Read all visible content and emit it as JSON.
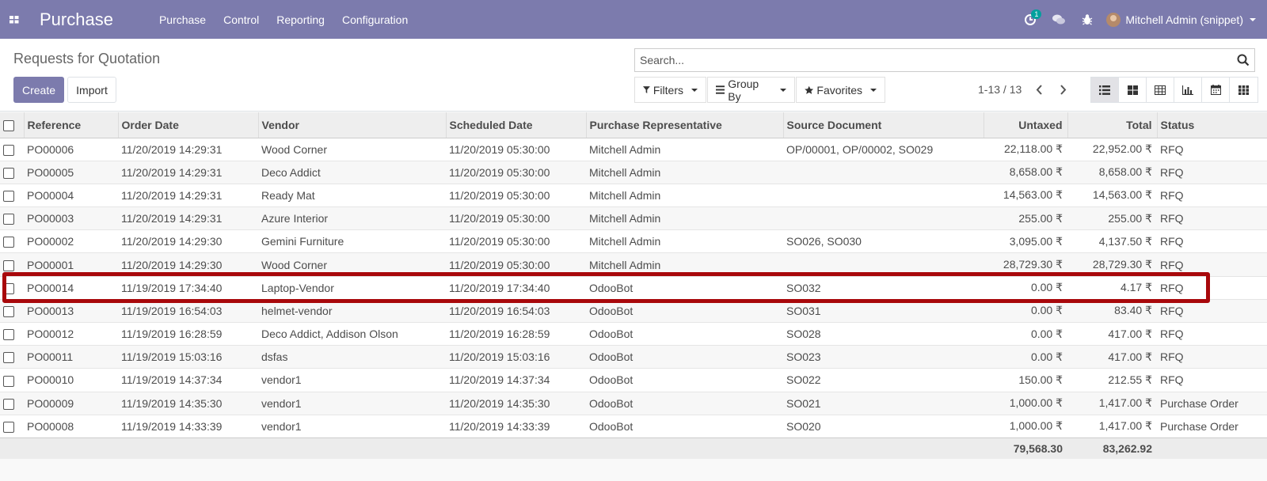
{
  "navbar": {
    "brand": "Purchase",
    "menu": [
      "Purchase",
      "Control",
      "Reporting",
      "Configuration"
    ],
    "activity_count": "1",
    "user": "Mitchell Admin (snippet)"
  },
  "control": {
    "title": "Requests for Quotation",
    "create_label": "Create",
    "import_label": "Import",
    "search_placeholder": "Search...",
    "filters_label": "Filters",
    "groupby_label": "Group By",
    "favorites_label": "Favorites",
    "pager": "1-13 / 13"
  },
  "table": {
    "columns": [
      "Reference",
      "Order Date",
      "Vendor",
      "Scheduled Date",
      "Purchase Representative",
      "Source Document",
      "Untaxed",
      "Total",
      "Status"
    ],
    "rows": [
      [
        "PO00006",
        "11/20/2019 14:29:31",
        "Wood Corner",
        "11/20/2019 05:30:00",
        "Mitchell Admin",
        "OP/00001, OP/00002, SO029",
        "22,118.00 ₹",
        "22,952.00 ₹",
        "RFQ"
      ],
      [
        "PO00005",
        "11/20/2019 14:29:31",
        "Deco Addict",
        "11/20/2019 05:30:00",
        "Mitchell Admin",
        "",
        "8,658.00 ₹",
        "8,658.00 ₹",
        "RFQ"
      ],
      [
        "PO00004",
        "11/20/2019 14:29:31",
        "Ready Mat",
        "11/20/2019 05:30:00",
        "Mitchell Admin",
        "",
        "14,563.00 ₹",
        "14,563.00 ₹",
        "RFQ"
      ],
      [
        "PO00003",
        "11/20/2019 14:29:31",
        "Azure Interior",
        "11/20/2019 05:30:00",
        "Mitchell Admin",
        "",
        "255.00 ₹",
        "255.00 ₹",
        "RFQ"
      ],
      [
        "PO00002",
        "11/20/2019 14:29:30",
        "Gemini Furniture",
        "11/20/2019 05:30:00",
        "Mitchell Admin",
        "SO026, SO030",
        "3,095.00 ₹",
        "4,137.50 ₹",
        "RFQ"
      ],
      [
        "PO00001",
        "11/20/2019 14:29:30",
        "Wood Corner",
        "11/20/2019 05:30:00",
        "Mitchell Admin",
        "",
        "28,729.30 ₹",
        "28,729.30 ₹",
        "RFQ"
      ],
      [
        "PO00014",
        "11/19/2019 17:34:40",
        "Laptop-Vendor",
        "11/20/2019 17:34:40",
        "OdooBot",
        "SO032",
        "0.00 ₹",
        "4.17 ₹",
        "RFQ"
      ],
      [
        "PO00013",
        "11/19/2019 16:54:03",
        "helmet-vendor",
        "11/20/2019 16:54:03",
        "OdooBot",
        "SO031",
        "0.00 ₹",
        "83.40 ₹",
        "RFQ"
      ],
      [
        "PO00012",
        "11/19/2019 16:28:59",
        "Deco Addict, Addison Olson",
        "11/20/2019 16:28:59",
        "OdooBot",
        "SO028",
        "0.00 ₹",
        "417.00 ₹",
        "RFQ"
      ],
      [
        "PO00011",
        "11/19/2019 15:03:16",
        "dsfas",
        "11/20/2019 15:03:16",
        "OdooBot",
        "SO023",
        "0.00 ₹",
        "417.00 ₹",
        "RFQ"
      ],
      [
        "PO00010",
        "11/19/2019 14:37:34",
        "vendor1",
        "11/20/2019 14:37:34",
        "OdooBot",
        "SO022",
        "150.00 ₹",
        "212.55 ₹",
        "RFQ"
      ],
      [
        "PO00009",
        "11/19/2019 14:35:30",
        "vendor1",
        "11/20/2019 14:35:30",
        "OdooBot",
        "SO021",
        "1,000.00 ₹",
        "1,417.00 ₹",
        "Purchase Order"
      ],
      [
        "PO00008",
        "11/19/2019 14:33:39",
        "vendor1",
        "11/20/2019 14:33:39",
        "OdooBot",
        "SO020",
        "1,000.00 ₹",
        "1,417.00 ₹",
        "Purchase Order"
      ]
    ],
    "totals": {
      "untaxed": "79,568.30",
      "total": "83,262.92"
    }
  },
  "colors": {
    "navbar": "#7c7bad",
    "highlight": "#a8080b"
  }
}
